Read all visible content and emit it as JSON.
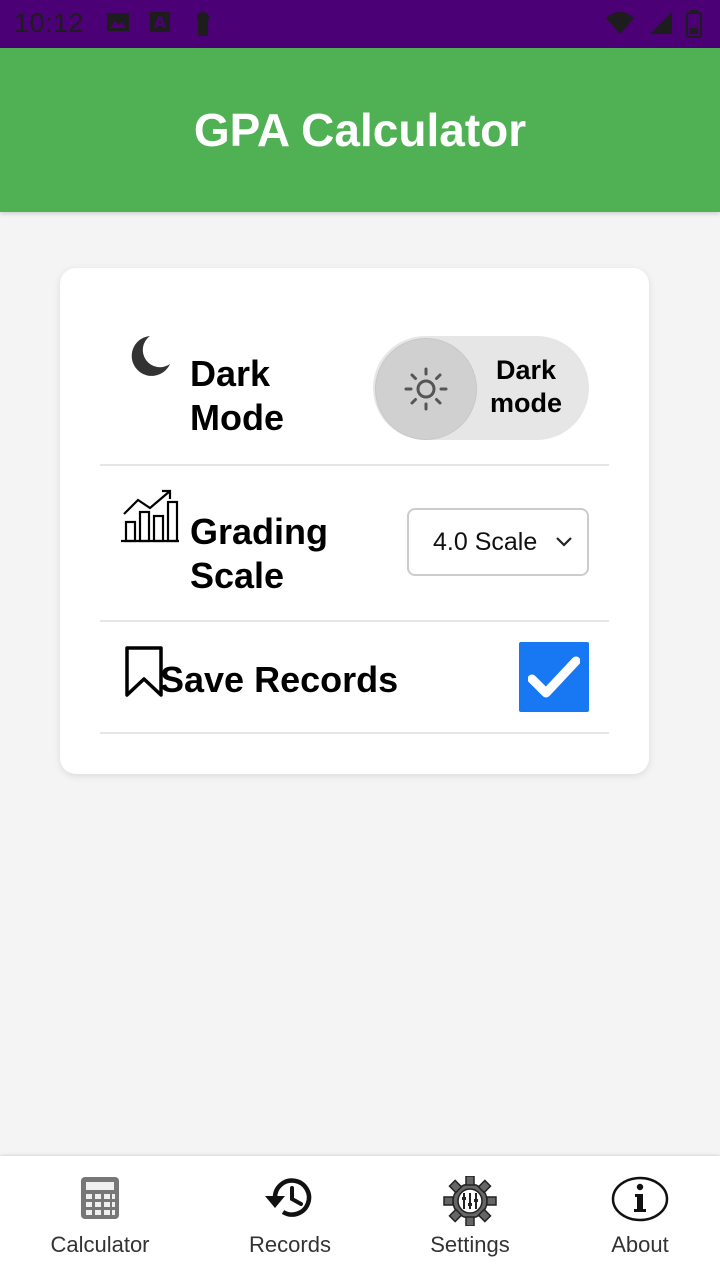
{
  "status_bar": {
    "time": "10:12",
    "icons_left": [
      "image-icon",
      "a-square-icon",
      "keyhole-icon"
    ],
    "icons_right": [
      "wifi-icon",
      "signal-icon",
      "battery-icon"
    ]
  },
  "app_bar": {
    "title": "GPA Calculator"
  },
  "settings": {
    "dark_mode": {
      "label": "Dark Mode",
      "icon": "moon-icon",
      "toggle_label": "Dark mode",
      "enabled": false
    },
    "grading_scale": {
      "label": "Grading Scale",
      "icon": "bar-chart-icon",
      "selected": "4.0 Scale"
    },
    "save_records": {
      "label": "Save Records",
      "icon": "bookmark-icon",
      "checked": true
    }
  },
  "bottom_nav": {
    "items": [
      {
        "label": "Calculator",
        "icon": "calculator-icon"
      },
      {
        "label": "Records",
        "icon": "history-icon"
      },
      {
        "label": "Settings",
        "icon": "gear-icon"
      },
      {
        "label": "About",
        "icon": "info-icon"
      }
    ]
  },
  "colors": {
    "status_bar": "#4b0075",
    "app_bar": "#4fb153",
    "checkbox": "#1877f2",
    "background": "#f4f4f4"
  }
}
